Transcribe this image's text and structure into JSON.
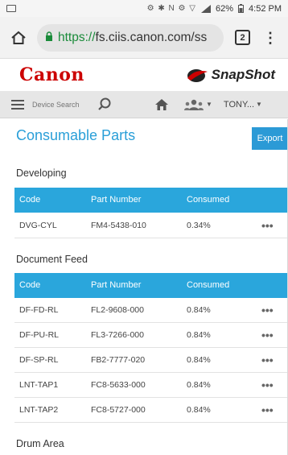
{
  "status_bar": {
    "icons": "⚙ ✱ N ⚙ ▽",
    "battery": "62%",
    "time": "4:52 PM"
  },
  "browser": {
    "url_scheme": "https://",
    "url_rest": "fs.ciis.canon.com/ss",
    "tab_count": "2"
  },
  "brand": {
    "logo": "Canon",
    "app_name": "SnapShot"
  },
  "toolbar": {
    "search_placeholder": "Device Search",
    "user_name": "TONY..."
  },
  "page": {
    "title": "Consumable Parts",
    "export_label": "Export"
  },
  "table_headers": {
    "code": "Code",
    "part_number": "Part Number",
    "consumed": "Consumed"
  },
  "row_action": "•••",
  "sections": [
    {
      "title": "Developing",
      "rows": [
        {
          "code": "DVG-CYL",
          "part_number": "FM4-5438-010",
          "consumed": "0.34%"
        }
      ]
    },
    {
      "title": "Document Feed",
      "rows": [
        {
          "code": "DF-FD-RL",
          "part_number": "FL2-9608-000",
          "consumed": "0.84%"
        },
        {
          "code": "DF-PU-RL",
          "part_number": "FL3-7266-000",
          "consumed": "0.84%"
        },
        {
          "code": "DF-SP-RL",
          "part_number": "FB2-7777-020",
          "consumed": "0.84%"
        },
        {
          "code": "LNT-TAP1",
          "part_number": "FC8-5633-000",
          "consumed": "0.84%"
        },
        {
          "code": "LNT-TAP2",
          "part_number": "FC8-5727-000",
          "consumed": "0.84%"
        }
      ]
    },
    {
      "title": "Drum Area",
      "rows": []
    }
  ],
  "colors": {
    "accent": "#2aa6dc",
    "title_blue": "#2a9fd8",
    "canon_red": "#cc0000",
    "lock_green": "#1a8b3a"
  }
}
